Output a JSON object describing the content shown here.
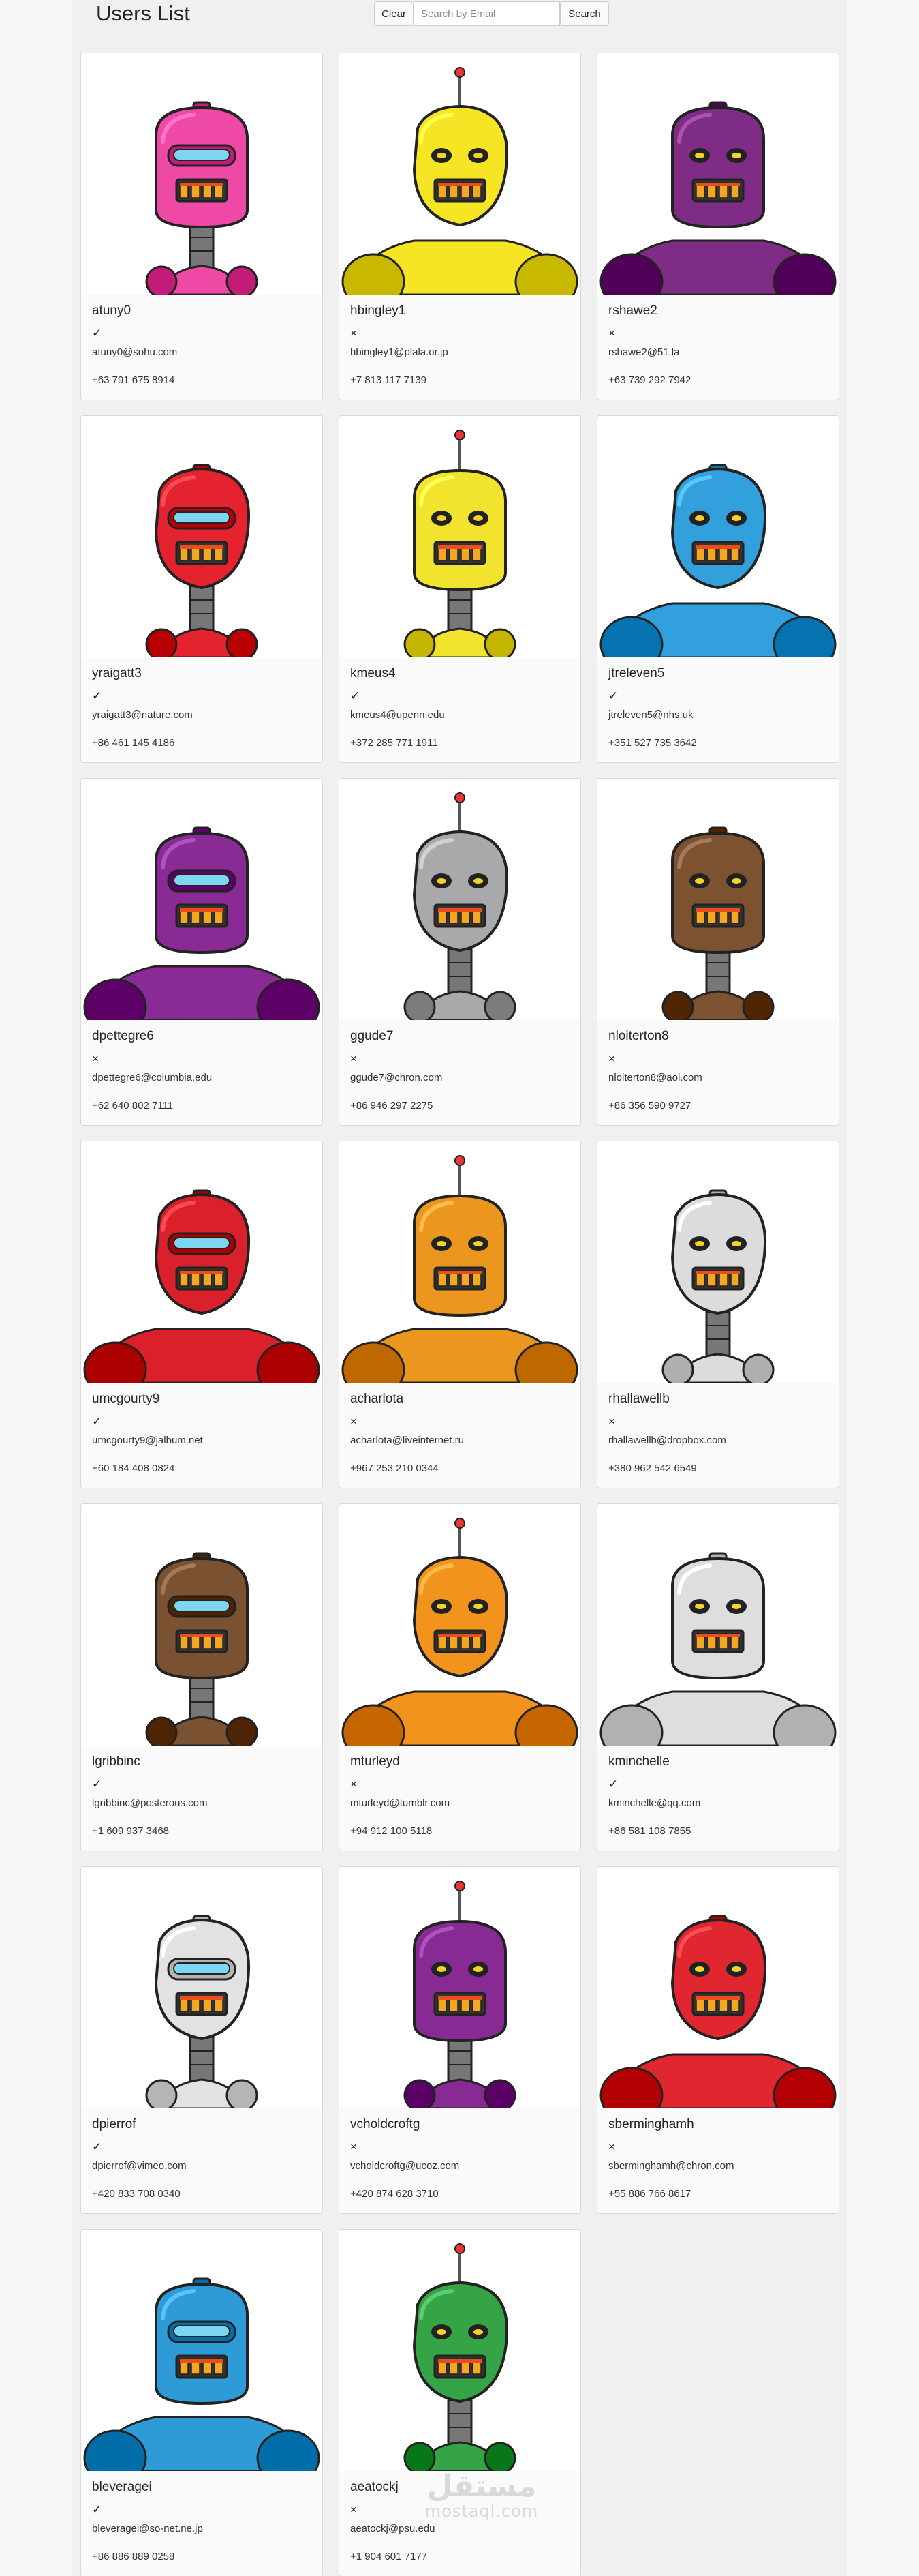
{
  "header": {
    "title": "Users List",
    "clear_label": "Clear",
    "search_placeholder": "Search by Email",
    "search_label": "Search"
  },
  "icons": {
    "active": "✓",
    "inactive": "×"
  },
  "users": [
    {
      "username": "atuny0",
      "active": true,
      "email": "atuny0@sohu.com",
      "phone": "+63 791 675 8914",
      "color": "#ee4aa5",
      "robot_icon": "robot-avatar-icon"
    },
    {
      "username": "hbingley1",
      "active": false,
      "email": "hbingley1@plala.or.jp",
      "phone": "+7 813 117 7139",
      "color": "#f5e524",
      "robot_icon": "robot-avatar-icon"
    },
    {
      "username": "rshawe2",
      "active": false,
      "email": "rshawe2@51.la",
      "phone": "+63 739 292 7942",
      "color": "#7e2c86",
      "robot_icon": "robot-avatar-icon"
    },
    {
      "username": "yraigatt3",
      "active": true,
      "email": "yraigatt3@nature.com",
      "phone": "+86 461 145 4186",
      "color": "#e5232f",
      "robot_icon": "robot-avatar-icon"
    },
    {
      "username": "kmeus4",
      "active": true,
      "email": "kmeus4@upenn.edu",
      "phone": "+372 285 771 1911",
      "color": "#f2e32e",
      "robot_icon": "robot-avatar-icon"
    },
    {
      "username": "jtreleven5",
      "active": true,
      "email": "jtreleven5@nhs.uk",
      "phone": "+351 527 735 3642",
      "color": "#31a0dc",
      "robot_icon": "robot-avatar-icon"
    },
    {
      "username": "dpettegre6",
      "active": false,
      "email": "dpettegre6@columbia.edu",
      "phone": "+62 640 802 7111",
      "color": "#8a2a94",
      "robot_icon": "robot-avatar-icon"
    },
    {
      "username": "ggude7",
      "active": false,
      "email": "ggude7@chron.com",
      "phone": "+86 946 297 2275",
      "color": "#a9a9ab",
      "robot_icon": "robot-avatar-icon"
    },
    {
      "username": "nloiterton8",
      "active": false,
      "email": "nloiterton8@aol.com",
      "phone": "+86 356 590 9727",
      "color": "#7c5230",
      "robot_icon": "robot-avatar-icon"
    },
    {
      "username": "umcgourty9",
      "active": true,
      "email": "umcgourty9@jalbum.net",
      "phone": "+60 184 408 0824",
      "color": "#d9202b",
      "robot_icon": "robot-avatar-icon"
    },
    {
      "username": "acharlota",
      "active": false,
      "email": "acharlota@liveinternet.ru",
      "phone": "+967 253 210 0344",
      "color": "#eb961f",
      "robot_icon": "robot-avatar-icon"
    },
    {
      "username": "rhallawellb",
      "active": false,
      "email": "rhallawellb@dropbox.com",
      "phone": "+380 962 542 6549",
      "color": "#dcdcdc",
      "robot_icon": "robot-avatar-icon"
    },
    {
      "username": "lgribbinc",
      "active": true,
      "email": "lgribbinc@posterous.com",
      "phone": "+1 609 937 3468",
      "color": "#7a5131",
      "robot_icon": "robot-avatar-icon"
    },
    {
      "username": "mturleyd",
      "active": false,
      "email": "mturleyd@tumblr.com",
      "phone": "+94 912 100 5118",
      "color": "#f2931e",
      "robot_icon": "robot-avatar-icon"
    },
    {
      "username": "kminchelle",
      "active": true,
      "email": "kminchelle@qq.com",
      "phone": "+86 581 108 7855",
      "color": "#dedede",
      "robot_icon": "robot-avatar-icon"
    },
    {
      "username": "dpierrof",
      "active": true,
      "email": "dpierrof@vimeo.com",
      "phone": "+420 833 708 0340",
      "color": "#e2e2e2",
      "robot_icon": "robot-avatar-icon"
    },
    {
      "username": "vcholdcroftg",
      "active": false,
      "email": "vcholdcroftg@ucoz.com",
      "phone": "+420 874 628 3710",
      "color": "#872a94",
      "robot_icon": "robot-avatar-icon"
    },
    {
      "username": "sberminghamh",
      "active": false,
      "email": "sberminghamh@chron.com",
      "phone": "+55 886 766 8617",
      "color": "#e0262f",
      "robot_icon": "robot-avatar-icon"
    },
    {
      "username": "bleveragei",
      "active": true,
      "email": "bleveragei@so-net.ne.jp",
      "phone": "+86 886 889 0258",
      "color": "#2f9bd6",
      "robot_icon": "robot-avatar-icon"
    },
    {
      "username": "aeatockj",
      "active": false,
      "email": "aeatockj@psu.edu",
      "phone": "+1 904 601 7177",
      "color": "#35a447",
      "robot_icon": "robot-avatar-icon"
    }
  ],
  "watermark": {
    "line1": "مستقل",
    "line2": "mostaql.com"
  }
}
